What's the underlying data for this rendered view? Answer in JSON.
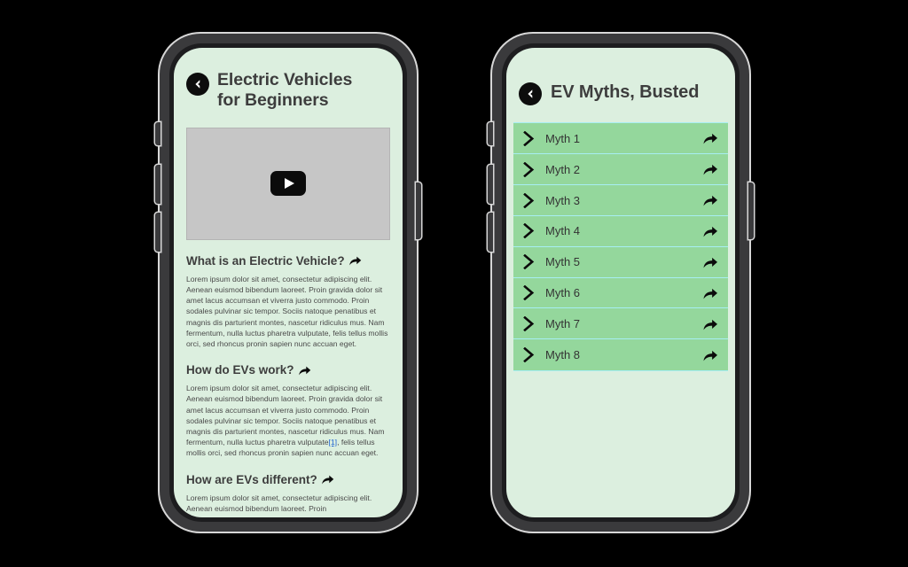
{
  "colors": {
    "screen_bg": "#dcefdf",
    "row_green": "#94d79c",
    "row_divider": "#a7eef3",
    "frame": "#3a3a3c",
    "text": "#3d3d3d",
    "link": "#1a5fd0",
    "video_placeholder": "#c6c6c6"
  },
  "phone_left": {
    "back_icon": "back-circle-icon",
    "title": "Electric Vehicles\nfor Beginners",
    "title_line1": "Electric Vehicles",
    "title_line2": "for Beginners",
    "video": {
      "icon": "youtube-play-icon",
      "label": ""
    },
    "sections": [
      {
        "heading": "What is an Electric Vehicle?",
        "share_icon": "share-arrow-icon",
        "body_pre": "Lorem ipsum dolor sit amet, consectetur adipiscing elit. Aenean euismod bibendum laoreet. Proin gravida dolor sit amet lacus accumsan et viverra justo commodo. Proin sodales pulvinar sic tempor. Sociis natoque penatibus et magnis dis parturient montes, nascetur ridiculus mus. Nam fermentum, nulla luctus pharetra vulputate, felis tellus mollis orci, sed rhoncus pronin sapien nunc accuan eget.",
        "link": "",
        "body_post": ""
      },
      {
        "heading": "How do EVs work?",
        "share_icon": "share-arrow-icon",
        "body_pre": "Lorem ipsum dolor sit amet, consectetur adipiscing elit. Aenean euismod bibendum laoreet. Proin gravida dolor sit amet lacus accumsan et viverra justo commodo. Proin sodales pulvinar sic tempor. Sociis natoque penatibus et magnis dis parturient montes, nascetur ridiculus mus. Nam fermentum, nulla luctus pharetra vulputate",
        "link": "[1]",
        "body_post": ", felis tellus mollis orci, sed rhoncus pronin sapien nunc accuan eget."
      },
      {
        "heading": "How are EVs different?",
        "share_icon": "share-arrow-icon",
        "body_pre": "Lorem ipsum dolor sit amet, consectetur adipiscing elit. Aenean euismod bibendum laoreet. Proin",
        "link": "",
        "body_post": ""
      }
    ]
  },
  "phone_right": {
    "back_icon": "back-circle-icon",
    "title": "EV Myths, Busted",
    "rows": [
      {
        "chevron_icon": "chevron-right-icon",
        "label": "Myth 1",
        "share_icon": "share-arrow-icon"
      },
      {
        "chevron_icon": "chevron-right-icon",
        "label": "Myth 2",
        "share_icon": "share-arrow-icon"
      },
      {
        "chevron_icon": "chevron-right-icon",
        "label": "Myth 3",
        "share_icon": "share-arrow-icon"
      },
      {
        "chevron_icon": "chevron-right-icon",
        "label": "Myth 4",
        "share_icon": "share-arrow-icon"
      },
      {
        "chevron_icon": "chevron-right-icon",
        "label": "Myth 5",
        "share_icon": "share-arrow-icon"
      },
      {
        "chevron_icon": "chevron-right-icon",
        "label": "Myth 6",
        "share_icon": "share-arrow-icon"
      },
      {
        "chevron_icon": "chevron-right-icon",
        "label": "Myth 7",
        "share_icon": "share-arrow-icon"
      },
      {
        "chevron_icon": "chevron-right-icon",
        "label": "Myth 8",
        "share_icon": "share-arrow-icon"
      }
    ]
  }
}
